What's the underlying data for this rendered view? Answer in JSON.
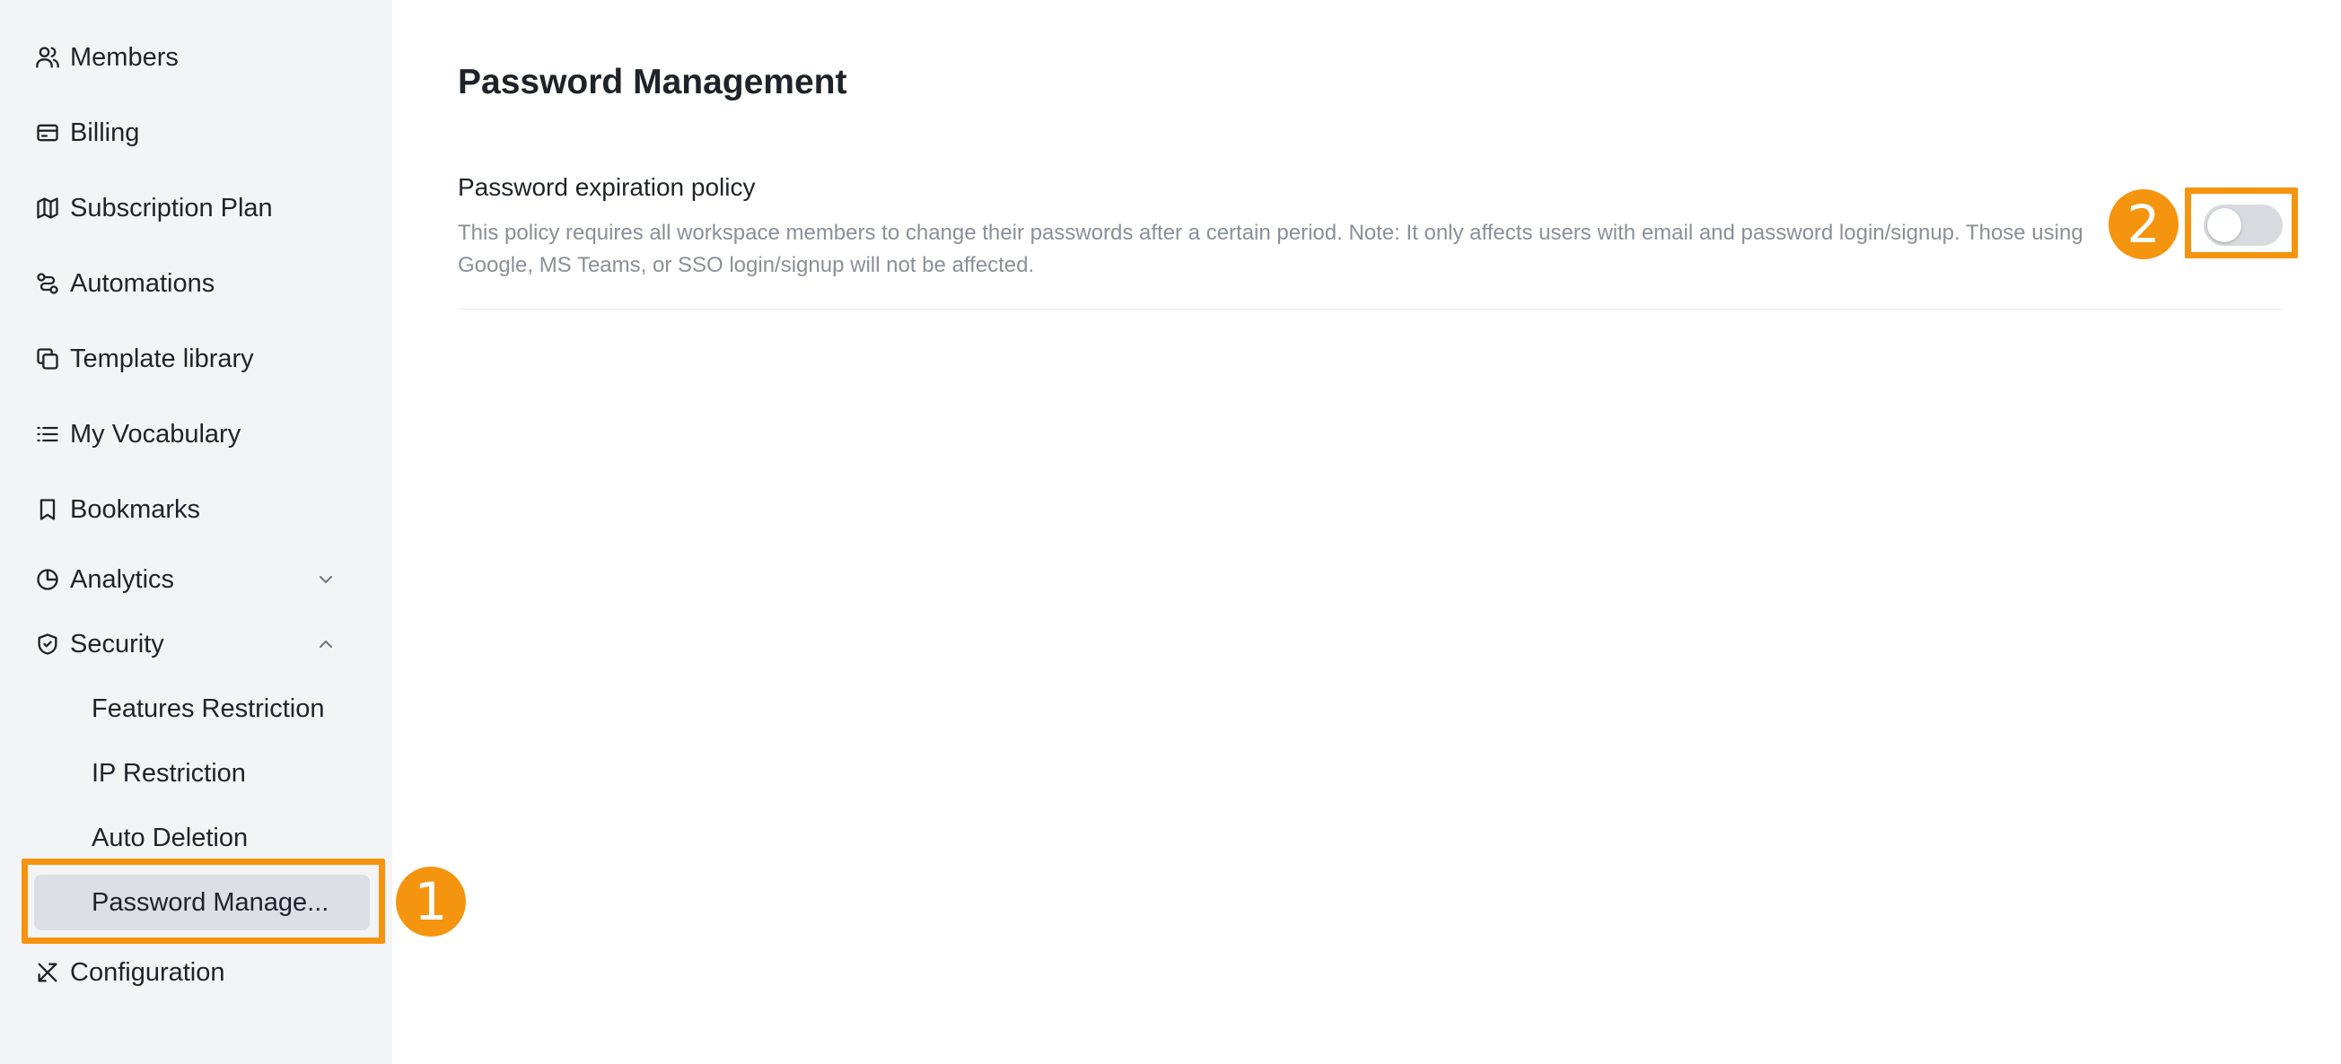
{
  "sidebar": {
    "items": [
      {
        "label": "Members",
        "icon": "users-icon"
      },
      {
        "label": "Billing",
        "icon": "credit-card-icon"
      },
      {
        "label": "Subscription Plan",
        "icon": "map-icon"
      },
      {
        "label": "Automations",
        "icon": "workflow-icon"
      },
      {
        "label": "Template library",
        "icon": "copy-icon"
      },
      {
        "label": "My Vocabulary",
        "icon": "list-icon"
      },
      {
        "label": "Bookmarks",
        "icon": "bookmark-icon"
      },
      {
        "label": "Analytics",
        "icon": "pie-chart-icon",
        "expanded": false
      },
      {
        "label": "Security",
        "icon": "shield-check-icon",
        "expanded": true
      },
      {
        "label": "Configuration",
        "icon": "tools-icon"
      }
    ],
    "security_subitems": [
      {
        "label": "Features Restriction"
      },
      {
        "label": "IP Restriction"
      },
      {
        "label": "Auto Deletion"
      },
      {
        "label": "Password Manage...",
        "active": true
      }
    ]
  },
  "main": {
    "title": "Password Management",
    "setting": {
      "title": "Password expiration policy",
      "description": "This policy requires all workspace members to change their passwords after a certain period. Note: It only affects users with email and password login/signup. Those using Google, MS Teams, or SSO login/signup will not be affected.",
      "enabled": false
    }
  },
  "annotations": [
    {
      "number": "1",
      "target": "Password Manage..."
    },
    {
      "number": "2",
      "target": "Password expiration policy toggle"
    }
  ],
  "colors": {
    "annotation": "#f5940e",
    "sidebar_bg": "#f3f4f6",
    "active_item_bg": "#dcdfe4",
    "toggle_off": "#d7dade"
  }
}
